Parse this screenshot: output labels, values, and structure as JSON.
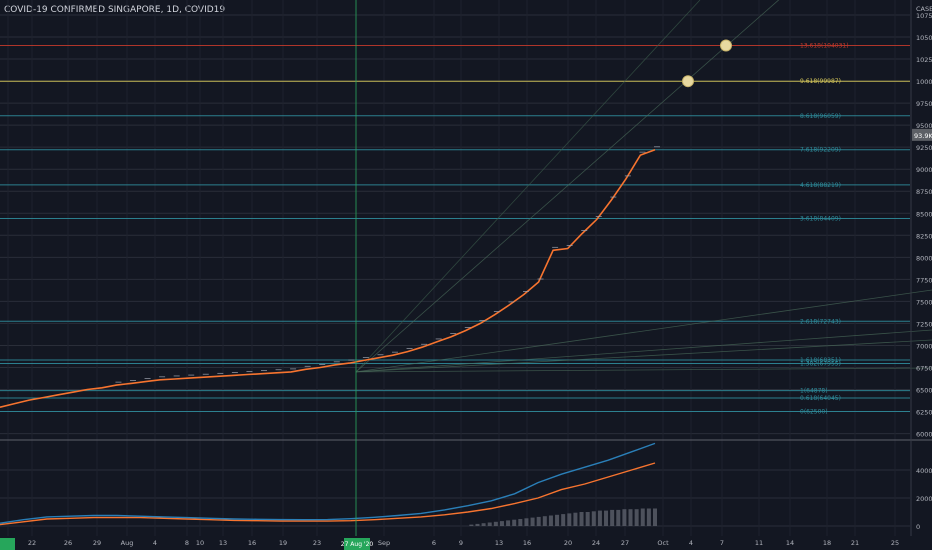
{
  "header": {
    "title": "COVID-19 CONFIRMED SINGAPORE, 1D, COVID19"
  },
  "colors": {
    "background": "#131722",
    "price_line": "#f7742f",
    "volume_ma_line": "#2a7fb8",
    "crosshair": "#26a65b",
    "fib_blue": "#2e8b9a",
    "fib_yellow": "#d8c95a",
    "fib_red": "#c0392b",
    "grid": "#2a2e39"
  },
  "chart_data": [
    {
      "type": "line",
      "title": "COVID-19 CONFIRMED SINGAPORE, 1D, COVID19",
      "y_axis_title": "CASES",
      "yscale": "linear",
      "ylim": [
        59500,
        109200
      ],
      "grid": true,
      "yticks": [
        60000,
        62500,
        65000,
        67500,
        70000,
        72500,
        75000,
        77500,
        80000,
        82500,
        85000,
        87500,
        90000,
        92500,
        95000,
        97500,
        100000,
        102500,
        105000,
        107500
      ],
      "x_tick_labels": [
        "19",
        "22",
        "26",
        "29",
        "Aug",
        "4",
        "8",
        "10",
        "13",
        "16",
        "19",
        "23",
        "27 Aug '20",
        "Sep",
        "6",
        "9",
        "13",
        "16",
        "20",
        "24",
        "27",
        "Oct",
        "4",
        "7",
        "11",
        "14",
        "18",
        "21",
        "25"
      ],
      "crosshair_x_label": "27 Aug '20",
      "last_value_label": "93.9K",
      "series": [
        {
          "values": [
            63000,
            63400,
            63800,
            64100,
            64400,
            64700,
            65000,
            65200,
            65500,
            65700,
            65900,
            66100,
            66200,
            66300,
            66400,
            66500,
            66600,
            66700,
            66800,
            66900,
            67000,
            67300,
            67500,
            67800,
            68000,
            68300,
            68600,
            68900,
            69300,
            69800,
            70400,
            71000,
            71700,
            72500,
            73500,
            74600,
            75800,
            77200,
            80800,
            81000,
            82700,
            84300,
            86500,
            88900,
            91600,
            92200
          ]
        }
      ],
      "fib_levels": [
        {
          "label": "0(62500)",
          "value": 62500,
          "color": "#2e8b9a"
        },
        {
          "label": "0.618(64045)",
          "value": 64045,
          "color": "#2e8b9a"
        },
        {
          "label": "1(64878)",
          "value": 64878,
          "color": "#2e8b9a"
        },
        {
          "label": "1.382(67955)",
          "value": 67955,
          "color": "#2e8b9a"
        },
        {
          "label": "1.618(68351)",
          "value": 68351,
          "color": "#2e8b9a"
        },
        {
          "label": "2.618(72743)",
          "value": 72743,
          "color": "#2e8b9a"
        },
        {
          "label": "3.618(84409)",
          "value": 84409,
          "color": "#2e8b9a"
        },
        {
          "label": "4.618(88219)",
          "value": 88219,
          "color": "#2e8b9a"
        },
        {
          "label": "7.618(92209)",
          "value": 92209,
          "color": "#2e8b9a"
        },
        {
          "label": "8.618(96059)",
          "value": 96059,
          "color": "#2e8b9a"
        },
        {
          "label": "9.618(99987)",
          "value": 99987,
          "color": "#d8c95a"
        },
        {
          "label": "13.618(104031)",
          "value": 104031,
          "color": "#c0392b"
        }
      ]
    },
    {
      "type": "bar",
      "yscale": "linear",
      "ylim": [
        -500,
        6000
      ],
      "yticks": [
        0,
        2000,
        4000
      ],
      "volume": [
        0,
        0,
        0,
        0,
        0,
        0,
        0,
        0,
        0,
        0,
        0,
        0,
        0,
        0,
        0,
        0,
        0,
        0,
        0,
        0,
        0,
        0,
        0,
        0,
        0,
        0,
        0,
        0,
        0,
        0,
        0,
        0,
        0,
        0,
        0,
        0,
        0,
        0,
        0,
        0,
        0,
        0,
        0,
        0,
        0,
        0,
        0,
        0,
        0,
        0,
        0,
        0,
        0,
        0,
        0,
        0,
        0,
        0,
        0,
        0,
        0,
        0,
        0,
        0,
        0,
        0,
        0,
        0,
        0,
        0,
        0,
        0,
        0,
        0,
        0,
        0,
        0,
        100,
        150,
        200,
        250,
        300,
        350,
        400,
        450,
        500,
        550,
        600,
        650,
        700,
        750,
        800,
        850,
        900,
        950,
        1000,
        1000,
        1050,
        1100,
        1100,
        1150,
        1150,
        1200,
        1200,
        1200,
        1250,
        1250,
        1250
      ],
      "series": [
        {
          "color": "#f7742f",
          "values": [
            100,
            300,
            500,
            550,
            600,
            600,
            600,
            550,
            500,
            450,
            400,
            380,
            360,
            350,
            350,
            380,
            450,
            550,
            650,
            800,
            1000,
            1250,
            1600,
            2000,
            2600,
            3000,
            3500,
            4000,
            4500
          ]
        },
        {
          "color": "#2a7fb8",
          "values": [
            200,
            450,
            650,
            700,
            750,
            750,
            700,
            650,
            600,
            550,
            500,
            480,
            460,
            450,
            460,
            520,
            620,
            750,
            900,
            1150,
            1450,
            1800,
            2300,
            3100,
            3700,
            4200,
            4700,
            5300,
            5900
          ]
        }
      ]
    }
  ]
}
